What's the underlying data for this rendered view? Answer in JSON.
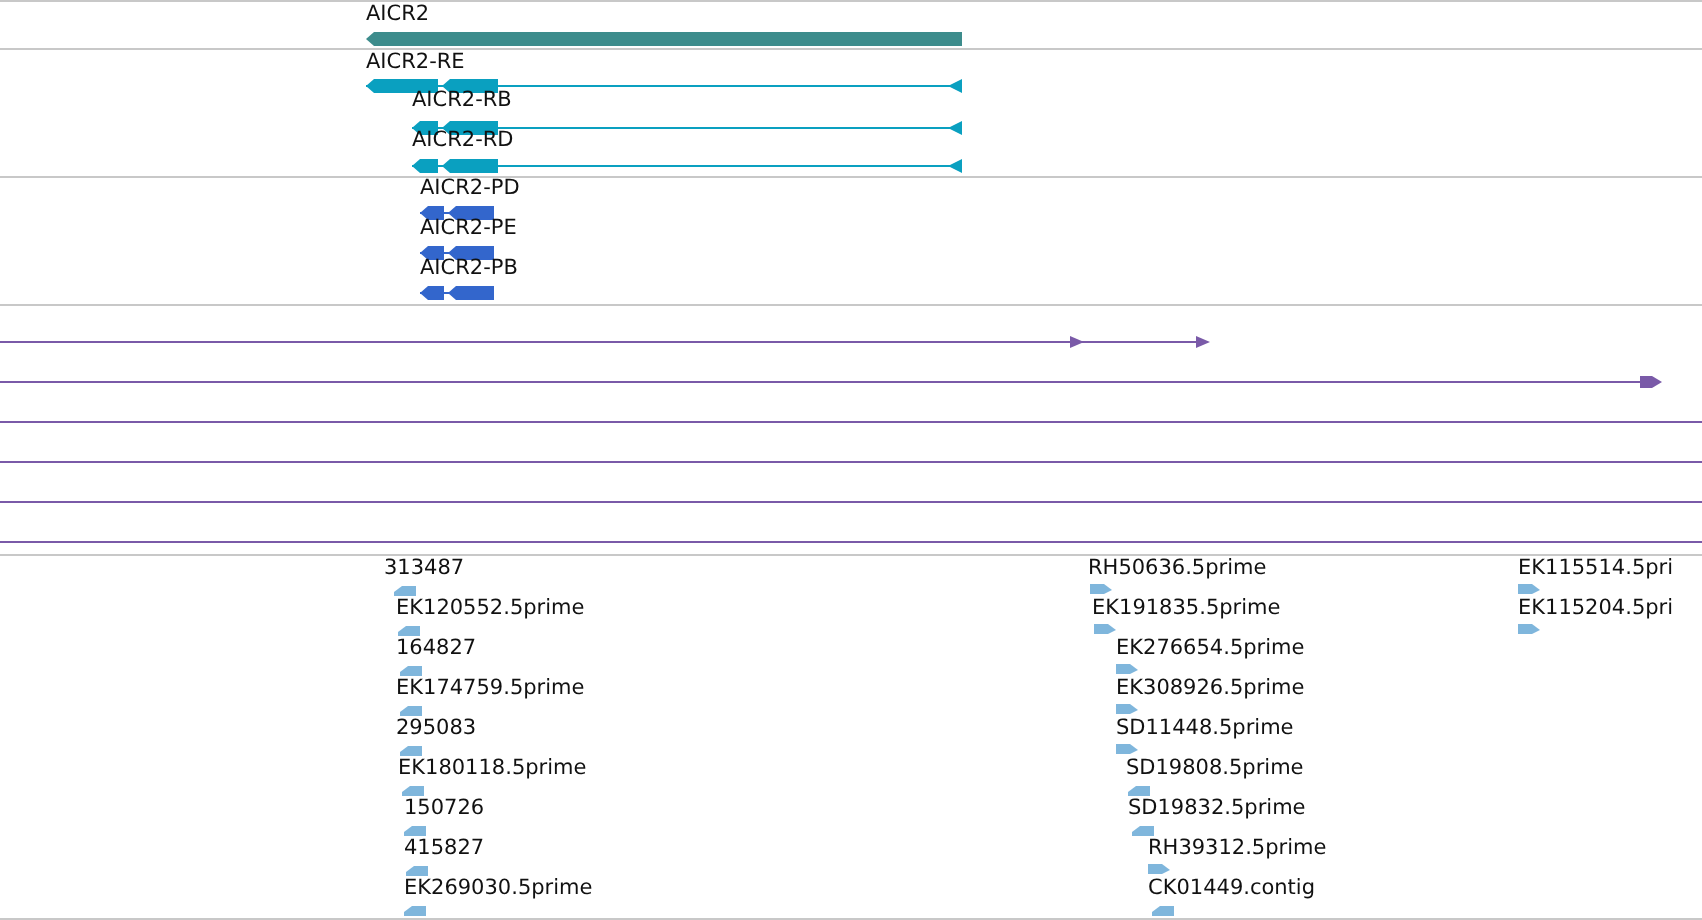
{
  "tracks": [
    {
      "kind": "gene",
      "features": [
        {
          "label": "AICR2",
          "reverse": true
        }
      ]
    },
    {
      "kind": "transcript",
      "features": [
        {
          "label": "AICR2-RE",
          "reverse": true
        },
        {
          "label": "AICR2-RB",
          "reverse": true
        },
        {
          "label": "AICR2-RD",
          "reverse": true
        }
      ]
    },
    {
      "kind": "protein",
      "features": [
        {
          "label": "AICR2-PD",
          "reverse": true
        },
        {
          "label": "AICR2-PE",
          "reverse": true
        },
        {
          "label": "AICR2-PB",
          "reverse": true
        }
      ]
    },
    {
      "kind": "alignment"
    },
    {
      "kind": "est",
      "features": [
        {
          "label": "313487",
          "reverse": true
        },
        {
          "label": "EK120552.5prime",
          "reverse": true
        },
        {
          "label": "164827",
          "reverse": true
        },
        {
          "label": "EK174759.5prime",
          "reverse": true
        },
        {
          "label": "295083",
          "reverse": true
        },
        {
          "label": "EK180118.5prime",
          "reverse": true
        },
        {
          "label": "150726",
          "reverse": true
        },
        {
          "label": "415827",
          "reverse": true
        },
        {
          "label": "EK269030.5prime",
          "reverse": true
        },
        {
          "label": "RH50636.5prime",
          "reverse": false
        },
        {
          "label": "EK191835.5prime",
          "reverse": false
        },
        {
          "label": "EK276654.5prime",
          "reverse": false
        },
        {
          "label": "EK308926.5prime",
          "reverse": false
        },
        {
          "label": "SD11448.5prime",
          "reverse": false
        },
        {
          "label": "SD19808.5prime",
          "reverse": true
        },
        {
          "label": "SD19832.5prime",
          "reverse": true
        },
        {
          "label": "RH39312.5prime",
          "reverse": false
        },
        {
          "label": "CK01449.contig",
          "reverse": true
        },
        {
          "label": "EK115514.5pri",
          "reverse": false
        },
        {
          "label": "EK115204.5pri",
          "reverse": false
        }
      ]
    }
  ]
}
